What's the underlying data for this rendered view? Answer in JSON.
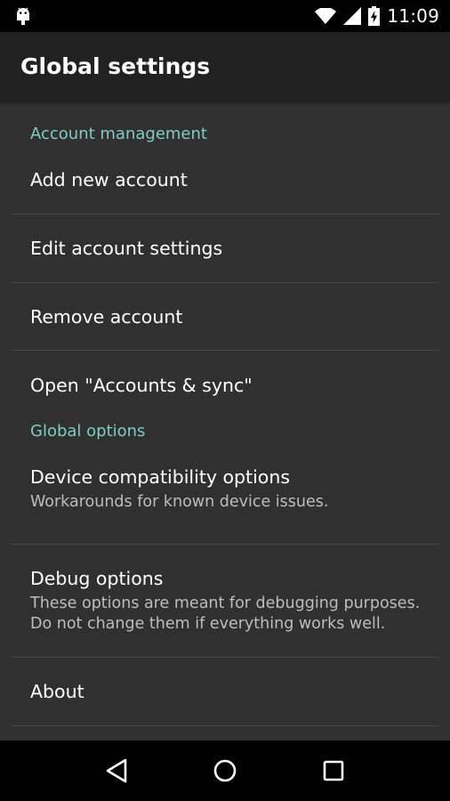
{
  "status_bar": {
    "time": "11:09",
    "icons": [
      "android-debug-icon",
      "wifi-icon",
      "signal-icon",
      "battery-charging-icon"
    ]
  },
  "app_bar": {
    "title": "Global settings"
  },
  "sections": [
    {
      "category": "Account management",
      "items": [
        {
          "title": "Add new account"
        },
        {
          "title": "Edit account settings"
        },
        {
          "title": "Remove account"
        },
        {
          "title": "Open \"Accounts & sync\""
        }
      ]
    },
    {
      "category": "Global options",
      "items": [
        {
          "title": "Device compatibility options",
          "summary": "Workarounds for known device issues."
        },
        {
          "title": "Debug options",
          "summary": "These options are meant for debugging purposes. Do not change them if everything works well."
        },
        {
          "title": "About"
        }
      ]
    }
  ],
  "colors": {
    "accent": "#80cbc4",
    "background": "#303030",
    "app_bar": "#212121",
    "divider": "#474747"
  },
  "nav_bar": {
    "icons": [
      "back-icon",
      "home-icon",
      "recents-icon"
    ]
  }
}
